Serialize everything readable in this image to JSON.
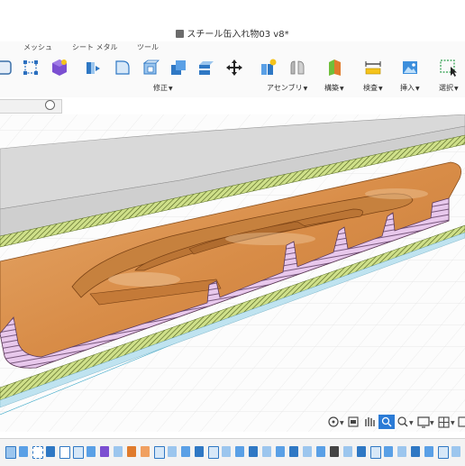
{
  "window": {
    "title": "スチール缶入れ物03 v8*"
  },
  "ribbon": {
    "tabs": [
      {
        "label": "メッシュ"
      },
      {
        "label": "シート メタル"
      },
      {
        "label": "ツール"
      }
    ],
    "groups": [
      {
        "label": "修正"
      },
      {
        "label": "アセンブリ"
      },
      {
        "label": "構築"
      },
      {
        "label": "検査"
      },
      {
        "label": "挿入"
      },
      {
        "label": "選択"
      }
    ]
  },
  "colors": {
    "cut_face": "#e8c8ec",
    "body_orange": "#d88c47",
    "hatch": "#6b4a6f",
    "accent_blue": "#2b7bd6",
    "grid": "#3aa8c8"
  }
}
